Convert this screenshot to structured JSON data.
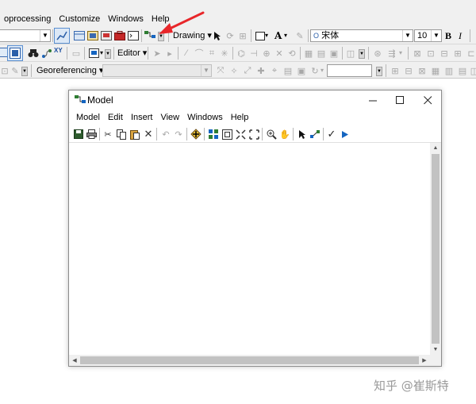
{
  "menu": [
    "oprocessing",
    "Customize",
    "Windows",
    "Help"
  ],
  "toolbar": {
    "layer_combo_value": "",
    "drawing_label": "Drawing",
    "font_name": "宋体",
    "font_size": "10",
    "bold": "B",
    "italic": "I",
    "editor_label": "Editor",
    "georef_label": "Georeferencing",
    "georef_layer_value": "",
    "georef_text_value": "",
    "font_color_glyph": "A"
  },
  "accent": {
    "annotation_arrow": "#e8262a",
    "highlight_border": "#5a8fd0"
  },
  "model_window": {
    "title": "Model",
    "controls": [
      "minimize-icon",
      "maximize-icon",
      "close-icon"
    ],
    "menu": [
      "Model",
      "Edit",
      "Insert",
      "View",
      "Windows",
      "Help"
    ]
  },
  "watermark": "知乎 @崔斯特"
}
